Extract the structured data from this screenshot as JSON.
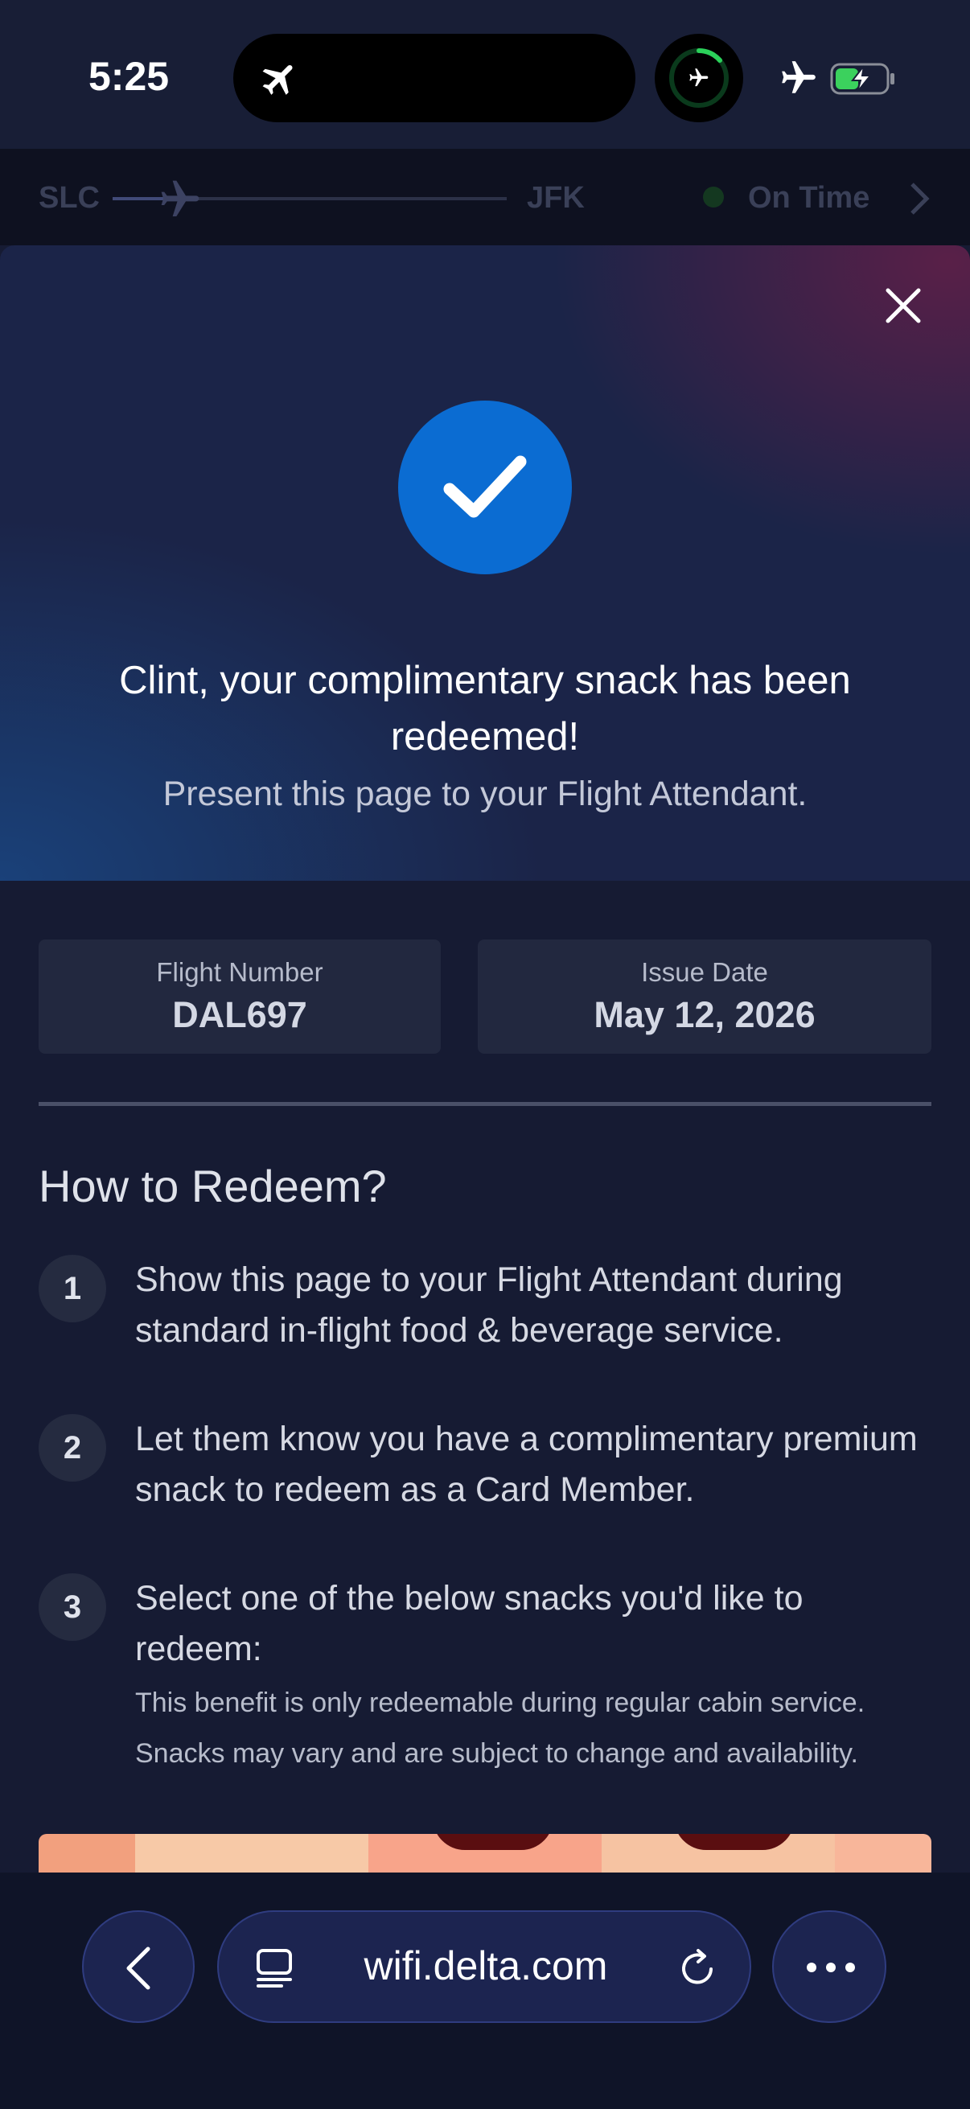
{
  "status_bar": {
    "time": "5:25"
  },
  "flight_strip": {
    "origin": "SLC",
    "destination": "JFK",
    "status": "On Time"
  },
  "hero": {
    "title": "Clint, your complimentary snack has been redeemed!",
    "subtitle": "Present this page to your Flight Attendant."
  },
  "info": {
    "flight_label": "Flight Number",
    "flight_value": "DAL697",
    "date_label": "Issue Date",
    "date_value": "May 12, 2026"
  },
  "redeem": {
    "title": "How to Redeem?",
    "steps": [
      {
        "num": "1",
        "text": "Show this page to your Flight Attendant during standard in-flight food & beverage service."
      },
      {
        "num": "2",
        "text": "Let them know you have a complimentary premium snack to redeem as a Card Member."
      },
      {
        "num": "3",
        "text": "Select one of the below snacks you'd like to redeem:"
      }
    ],
    "note_1": "This benefit is only redeemable during regular cabin service.",
    "note_2": "Snacks may vary and are subject to change and availability."
  },
  "browser": {
    "url": "wifi.delta.com"
  },
  "colors": {
    "accent": "#0b6cd2",
    "background": "#161b33",
    "status_dot": "#1f7a3a"
  },
  "icons": [
    "airplane-icon",
    "battery-charging-icon",
    "close-icon",
    "checkmark-icon",
    "chevron-right-icon",
    "back-arrow-icon",
    "tabs-icon",
    "reload-icon",
    "more-icon"
  ]
}
